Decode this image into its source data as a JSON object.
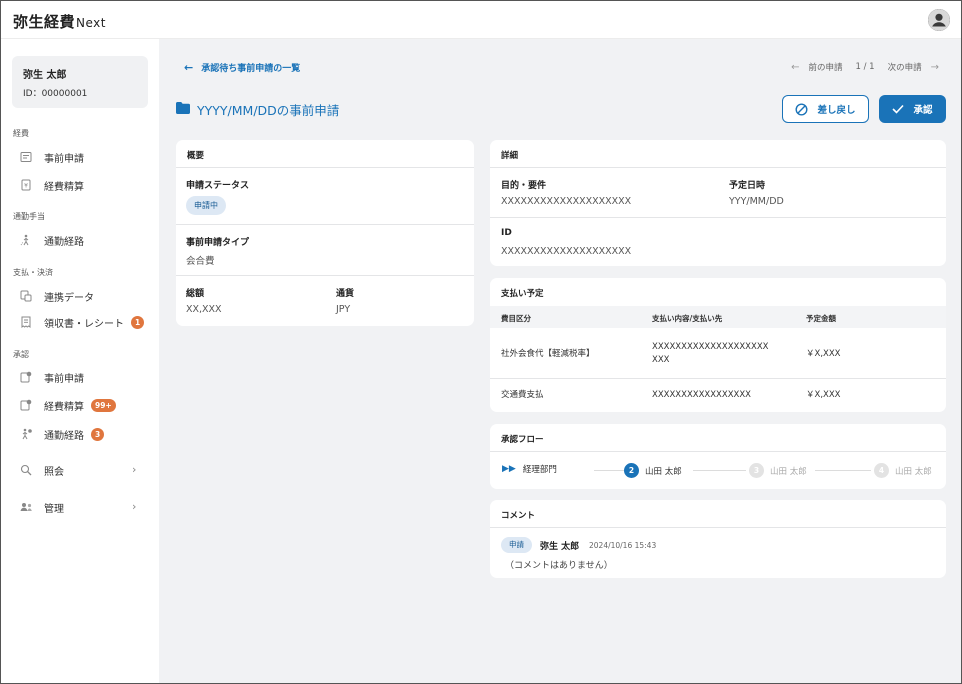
{
  "app": {
    "brand": "弥生経費",
    "brand_suffix": "Next"
  },
  "user": {
    "name": "弥生 太郎",
    "id": "ID：00000001"
  },
  "sidebar": {
    "sections": [
      {
        "heading": "経費"
      },
      {
        "heading": "通勤手当"
      },
      {
        "heading": "支払・決済"
      },
      {
        "heading": "承認"
      }
    ],
    "items": [
      {
        "label": "事前申請",
        "icon": "pre-application-icon"
      },
      {
        "label": "経費精算",
        "icon": "expense-settlement-icon"
      },
      {
        "label": "通勤経路",
        "icon": "commute-route-icon"
      },
      {
        "label": "連携データ",
        "icon": "linked-data-icon"
      },
      {
        "label": "領収書・レシート",
        "icon": "receipt-icon",
        "badge": "1"
      },
      {
        "label": "事前申請",
        "icon": "approval-pre-application-icon"
      },
      {
        "label": "経費精算",
        "icon": "approval-expense-icon",
        "badge": "99+"
      },
      {
        "label": "通勤経路",
        "icon": "approval-commute-icon",
        "badge": "3"
      },
      {
        "label": "照会",
        "icon": "inquiry-icon"
      },
      {
        "label": "管理",
        "icon": "admin-icon"
      }
    ]
  },
  "main": {
    "back_label": "承認待ち事前申請の一覧",
    "pager": {
      "prev": "前の申請",
      "count": "1 / 1",
      "next": "次の申請"
    },
    "title": "YYYY/MM/DDの事前申請",
    "reject_label": "差し戻し",
    "approve_label": "承認"
  },
  "summary": {
    "title": "概要",
    "status_label": "申請ステータス",
    "status_value": "申請中",
    "type_label": "事前申請タイプ",
    "type_value": "会合費",
    "total_label": "総額",
    "total_value": "XX,XXX",
    "currency_label": "通貨",
    "currency_value": "JPY"
  },
  "detail": {
    "title": "詳細",
    "purpose_label": "目的・要件",
    "purpose_value": "XXXXXXXXXXXXXXXXXXXX",
    "date_label": "予定日時",
    "date_value": "YYY/MM/DD",
    "id_label": "ID",
    "id_value": "XXXXXXXXXXXXXXXXXXXX"
  },
  "payment": {
    "title": "支払い予定",
    "columns": [
      "費目区分",
      "支払い内容/支払い先",
      "予定金額"
    ],
    "rows": [
      {
        "category": "社外会食代【軽減税率】",
        "content_1": "XXXXXXXXXXXXXXXXXXXX",
        "content_2": "XXX",
        "amount": "￥X,XXX"
      },
      {
        "category": "交通費支払",
        "content_1": "XXXXXXXXXXXXXXXXX",
        "content_2": "",
        "amount": "￥X,XXX"
      }
    ]
  },
  "flow": {
    "title": "承認フロー",
    "steps": [
      {
        "label": "経理部門",
        "marker": "▶▶"
      },
      {
        "num": "2",
        "label": "山田 太郎"
      },
      {
        "num": "3",
        "label": "山田 太郎"
      },
      {
        "num": "4",
        "label": "山田 太郎"
      }
    ],
    "active_color": "#1a73b8",
    "inactive_color": "#d9d9d9"
  },
  "comment": {
    "title": "コメント",
    "tag": "申請",
    "author": "弥生 太郎",
    "timestamp": "2024/10/16 15:43",
    "body": "（コメントはありません）"
  },
  "colors": {
    "accent": "#1a73b8",
    "badge": "#e0763e",
    "background": "#f1f2f4"
  }
}
